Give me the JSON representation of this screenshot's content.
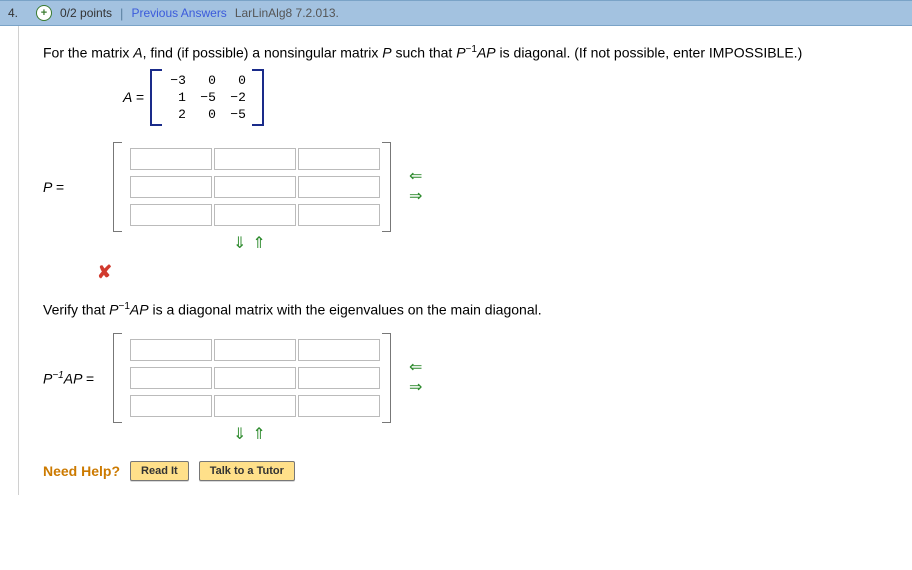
{
  "header": {
    "number": "4.",
    "points": "0/2 points",
    "sep": "|",
    "prev": "Previous Answers",
    "ref": "LarLinAlg8 7.2.013."
  },
  "prompt": {
    "p1": "For the matrix ",
    "A": "A",
    "p2": ", find (if possible) a nonsingular matrix ",
    "P": "P",
    "p3": " such that ",
    "Pinv": "P",
    "neg1a": "−1",
    "AP": "AP",
    "p4": " is diagonal. (If not possible, enter IMPOSSIBLE.)"
  },
  "matrixA": {
    "label": "A =",
    "r1c1": "−3",
    "r1c2": "0",
    "r1c3": "0",
    "r2c1": "1",
    "r2c2": "−5",
    "r2c3": "−2",
    "r3c1": "2",
    "r3c2": "0",
    "r3c3": "−5"
  },
  "P": {
    "label": "P ="
  },
  "verify": {
    "v1": "Verify that ",
    "P": "P",
    "neg1": "−1",
    "AP": "AP",
    "v2": " is a diagonal matrix with the eigenvalues on the main diagonal."
  },
  "D": {
    "label_html_P": "P",
    "label_neg1": "−1",
    "label_AP": "AP ="
  },
  "help": {
    "label": "Need Help?",
    "read": "Read It",
    "tutor": "Talk to a Tutor"
  }
}
